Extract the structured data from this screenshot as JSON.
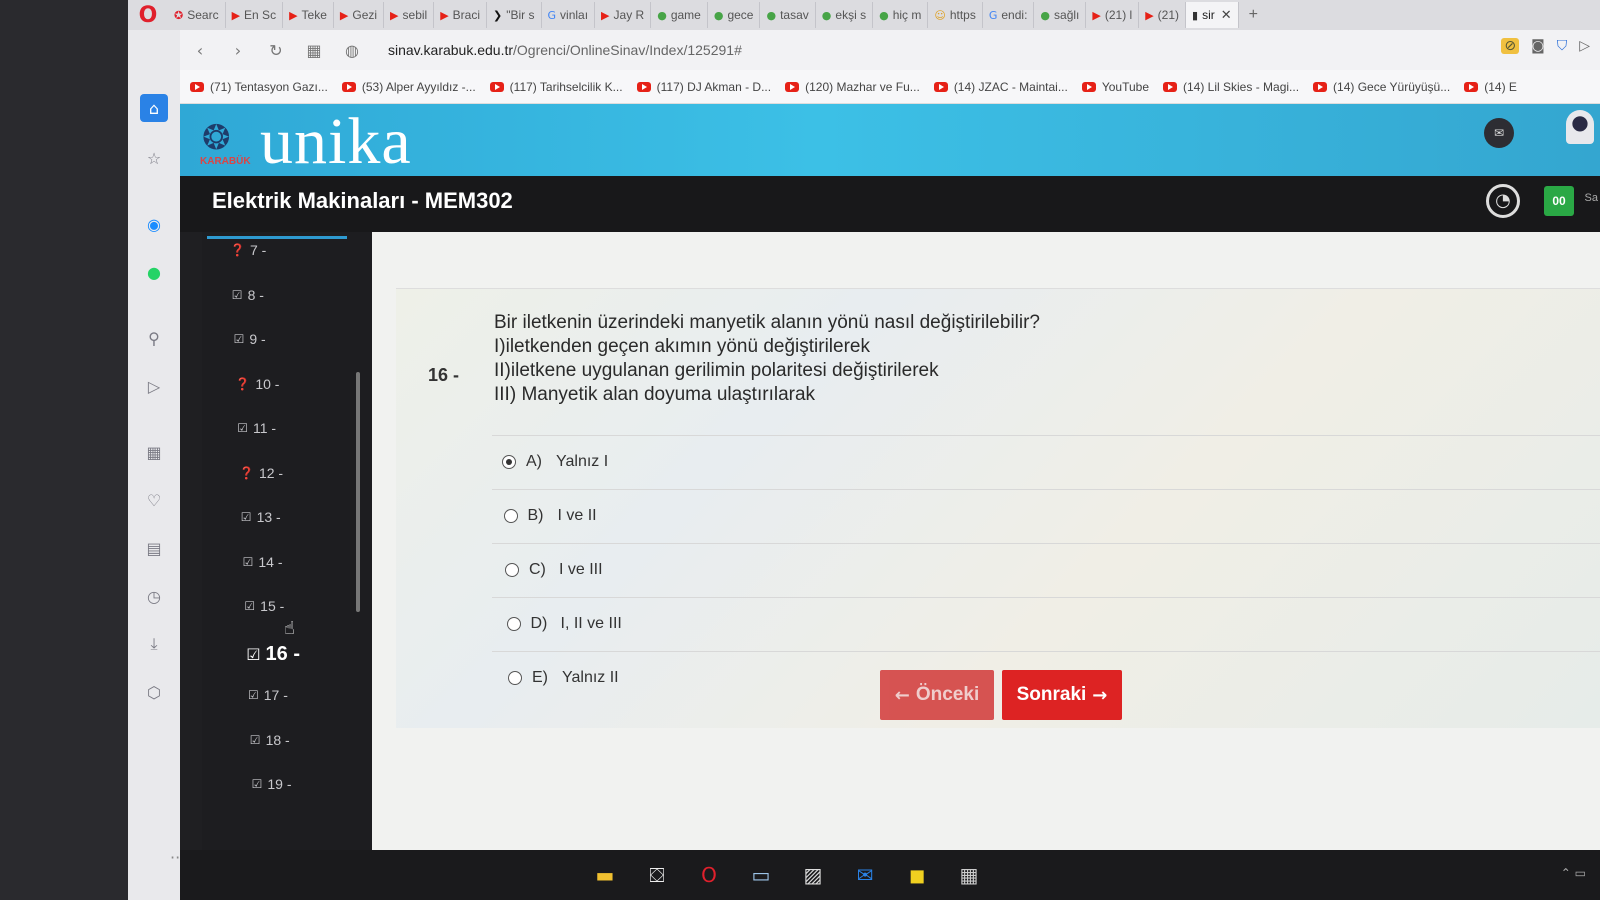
{
  "browser": {
    "tabs": [
      {
        "label": "Searc",
        "icon": "✪",
        "color": "#e0202c"
      },
      {
        "label": "En Sc",
        "icon": "▶",
        "color": "#e62117"
      },
      {
        "label": "Teke",
        "icon": "▶",
        "color": "#e62117"
      },
      {
        "label": "Gezi",
        "icon": "▶",
        "color": "#e62117"
      },
      {
        "label": "sebil",
        "icon": "▶",
        "color": "#e62117"
      },
      {
        "label": "Braci",
        "icon": "▶",
        "color": "#e62117"
      },
      {
        "label": "\"Bir s",
        "icon": "❯",
        "color": "#111111"
      },
      {
        "label": "vinlaı",
        "icon": "G",
        "color": "#4285f4"
      },
      {
        "label": "Jay R",
        "icon": "▶",
        "color": "#e62117"
      },
      {
        "label": "game",
        "icon": "●",
        "color": "#47a447"
      },
      {
        "label": "gece",
        "icon": "●",
        "color": "#47a447"
      },
      {
        "label": "tasav",
        "icon": "●",
        "color": "#47a447"
      },
      {
        "label": "ekşi s",
        "icon": "●",
        "color": "#47a447"
      },
      {
        "label": "hiç m",
        "icon": "●",
        "color": "#47a447"
      },
      {
        "label": "https",
        "icon": "☺",
        "color": "#e0a020"
      },
      {
        "label": "endi:",
        "icon": "G",
        "color": "#4285f4"
      },
      {
        "label": "sağlı",
        "icon": "●",
        "color": "#47a447"
      },
      {
        "label": "(21) l",
        "icon": "▶",
        "color": "#e62117"
      },
      {
        "label": "(21)",
        "icon": "▶",
        "color": "#e62117"
      },
      {
        "label": "sir",
        "icon": "▮",
        "color": "#333333",
        "active": true
      }
    ],
    "url_host": "sinav.karabuk.edu.tr",
    "url_path": "/Ogrenci/OnlineSinav/Index/125291#",
    "bookmarks": [
      "(71) Tentasyon Gazı...",
      "(53) Alper Ayyıldız -...",
      "(117) Tarihselcilik K...",
      "(117) DJ Akman - D...",
      "(120) Mazhar ve Fu...",
      "(14) JZAC - Maintai...",
      "YouTube",
      "(14) Lil Skies - Magi...",
      "(14) Gece Yürüyüşü...",
      "(14) E"
    ]
  },
  "header": {
    "brand": "unika",
    "owl_caption": "KARABÜK",
    "course_title": "Elektrik Makinaları - MEM302",
    "timer_value": "00",
    "timer_label": "Sa"
  },
  "question_nav": {
    "items": [
      {
        "num": "7 -",
        "status": "unanswered"
      },
      {
        "num": "8 -",
        "status": "answered"
      },
      {
        "num": "9 -",
        "status": "answered"
      },
      {
        "num": "10 -",
        "status": "unanswered"
      },
      {
        "num": "11 -",
        "status": "answered"
      },
      {
        "num": "12 -",
        "status": "unanswered"
      },
      {
        "num": "13 -",
        "status": "answered"
      },
      {
        "num": "14 -",
        "status": "answered"
      },
      {
        "num": "15 -",
        "status": "answered"
      },
      {
        "num": "16 -",
        "status": "answered",
        "current": true
      },
      {
        "num": "17 -",
        "status": "answered"
      },
      {
        "num": "18 -",
        "status": "answered"
      },
      {
        "num": "19 -",
        "status": "answered"
      }
    ]
  },
  "question": {
    "number": "16 -",
    "lines": [
      "Bir iletkenin üzerindeki manyetik alanın yönü nasıl değiştirilebilir?",
      "I)iletkenden geçen akımın yönü değiştirilerek",
      "II)iletkene uygulanan gerilimin polaritesi değiştirilerek",
      "III) Manyetik alan doyuma ulaştırılarak"
    ],
    "options": [
      {
        "letter": "A)",
        "text": "Yalnız I",
        "selected": true
      },
      {
        "letter": "B)",
        "text": "I ve II",
        "selected": false
      },
      {
        "letter": "C)",
        "text": "I ve III",
        "selected": false
      },
      {
        "letter": "D)",
        "text": "I, II ve III",
        "selected": false
      },
      {
        "letter": "E)",
        "text": "Yalnız II",
        "selected": false
      }
    ]
  },
  "buttons": {
    "prev": "Önceki",
    "next": "Sonraki"
  }
}
